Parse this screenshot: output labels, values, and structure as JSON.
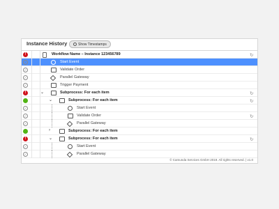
{
  "header": {
    "title": "Instance History",
    "timestamps_button": "Show Timestamps"
  },
  "rows": [
    {
      "status": "error",
      "indent": 0,
      "caret": "",
      "icon": "doc-icon",
      "label": "Workflow Name – Instance 123456789",
      "bold": true,
      "retry": true,
      "selected": false
    },
    {
      "status": "ok",
      "indent": 1,
      "caret": "",
      "icon": "circle",
      "label": "Start Event",
      "bold": false,
      "retry": false,
      "selected": true
    },
    {
      "status": "ok",
      "indent": 1,
      "caret": "",
      "icon": "task",
      "label": "Validate Order",
      "bold": false,
      "retry": false,
      "selected": false
    },
    {
      "status": "ok",
      "indent": 1,
      "caret": "",
      "icon": "gateway",
      "label": "Parallel Gateway",
      "bold": false,
      "retry": false,
      "selected": false
    },
    {
      "status": "ok",
      "indent": 1,
      "caret": "",
      "icon": "task",
      "label": "Trigger Payment",
      "bold": false,
      "retry": false,
      "selected": false
    },
    {
      "status": "error",
      "indent": 1,
      "caret": "⌄",
      "icon": "sub",
      "label": "Subprocess: For each item",
      "bold": true,
      "retry": true,
      "selected": false
    },
    {
      "status": "green",
      "indent": 2,
      "caret": "⌄",
      "icon": "sub",
      "label": "Subprocess: For each item",
      "bold": true,
      "retry": true,
      "selected": false
    },
    {
      "status": "ok",
      "indent": 3,
      "caret": "",
      "icon": "circle",
      "label": "Start Event",
      "bold": false,
      "retry": false,
      "selected": false
    },
    {
      "status": "ok",
      "indent": 3,
      "caret": "",
      "icon": "task",
      "label": "Validate Order",
      "bold": false,
      "retry": true,
      "selected": false
    },
    {
      "status": "ok",
      "indent": 3,
      "caret": "",
      "icon": "gateway",
      "label": "Parallel Gateway",
      "bold": false,
      "retry": false,
      "selected": false
    },
    {
      "status": "green",
      "indent": 2,
      "caret": "›",
      "icon": "sub",
      "label": "Subprocess: For each item",
      "bold": true,
      "retry": false,
      "selected": false
    },
    {
      "status": "error",
      "indent": 2,
      "caret": "⌄",
      "icon": "sub",
      "label": "Subprocess: For each item",
      "bold": true,
      "retry": true,
      "selected": false
    },
    {
      "status": "ok",
      "indent": 3,
      "caret": "",
      "icon": "circle",
      "label": "Start Event",
      "bold": false,
      "retry": false,
      "selected": false
    },
    {
      "status": "ok",
      "indent": 3,
      "caret": "",
      "icon": "gateway",
      "label": "Parallel Gateway",
      "bold": false,
      "retry": false,
      "selected": false
    }
  ],
  "footer": "© Camunda Services GmbH 2019. All rights reserved. | v1.0",
  "colors": {
    "selected": "#4d90fe",
    "error": "#d0121b",
    "completed": "#52b415"
  }
}
